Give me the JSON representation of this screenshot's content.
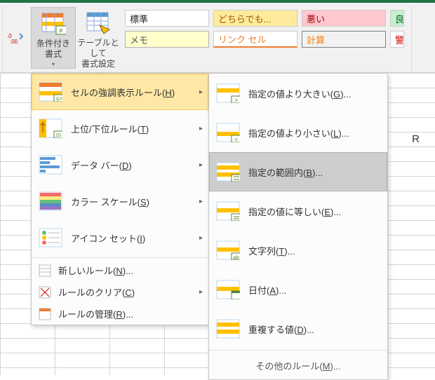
{
  "ribbon": {
    "decimals_label": ".0 .00",
    "conditional_formatting": "条件付き\n書式",
    "format_as_table": "テーブルとして\n書式設定",
    "styles": {
      "normal": "標準",
      "neutral": "どちらでも...",
      "bad": "悪い",
      "good_sliver": "良",
      "memo": "メモ",
      "link": "リンク セル",
      "calc": "計算",
      "warn_sliver": "警"
    }
  },
  "menu1": {
    "highlight_rules": "セルの強調表示ルール(<u>H</u>)",
    "top_bottom_rules": "上位/下位ルール(<u>T</u>)",
    "data_bars": "データ バー(<u>D</u>)",
    "color_scales": "カラー スケール(<u>S</u>)",
    "icon_sets": "アイコン セット(<u>I</u>)",
    "new_rule": "新しいルール(<u>N</u>)...",
    "clear_rules": "ルールのクリア(<u>C</u>)",
    "manage_rules": "ルールの管理(<u>R</u>)..."
  },
  "menu2": {
    "greater_than": "指定の値より大きい(<u>G</u>)...",
    "less_than": "指定の値より小さい(<u>L</u>)...",
    "between": "指定の範囲内(<u>B</u>)...",
    "equal_to": "指定の値に等しい(<u>E</u>)...",
    "text_contains": "文字列(<u>T</u>)...",
    "date_occurring": "日付(<u>A</u>)...",
    "duplicate_values": "重複する値(<u>D</u>)...",
    "more_rules": "その他のルール(<u>M</u>)..."
  },
  "grid": {
    "col_R": "R"
  }
}
